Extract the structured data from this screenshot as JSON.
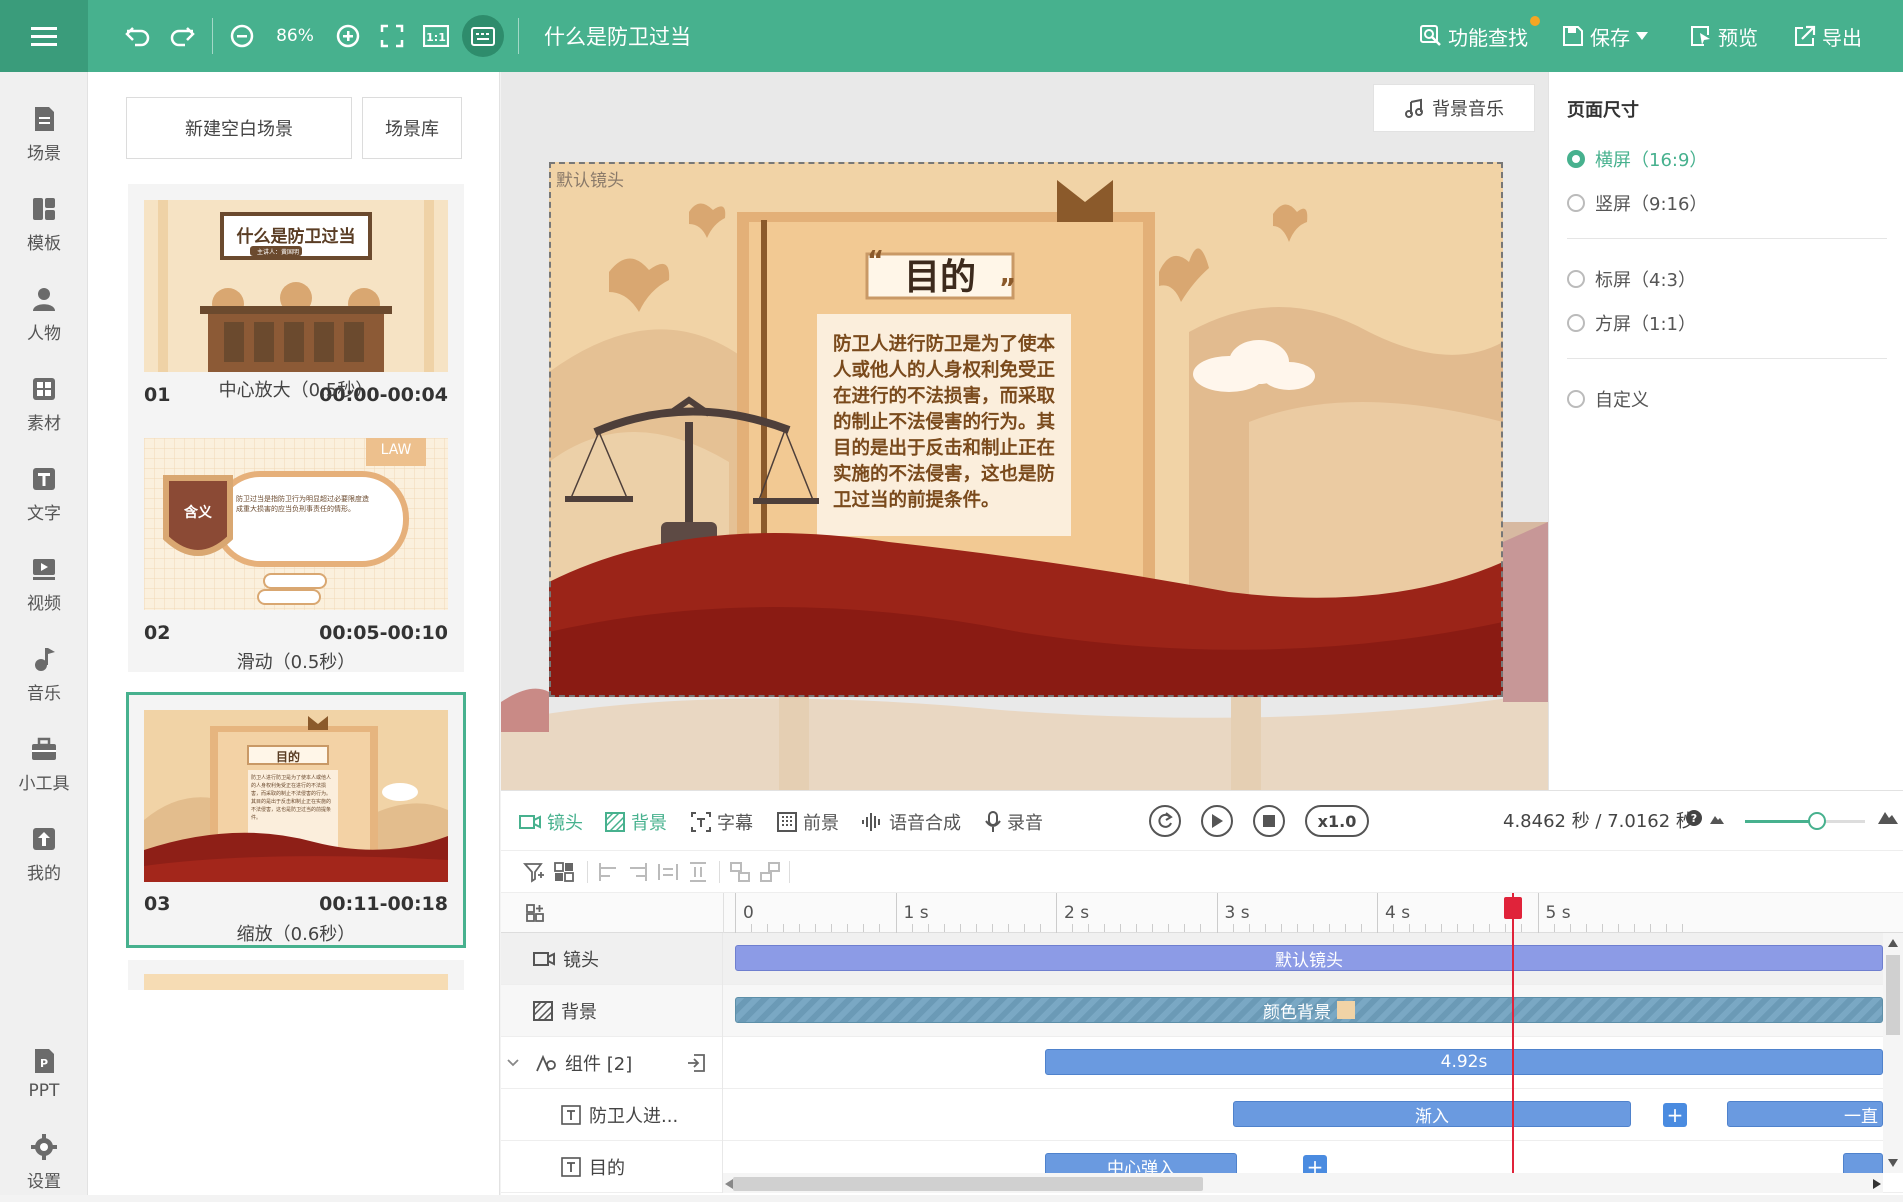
{
  "toolbar": {
    "zoom": "86%",
    "title": "什么是防卫过当",
    "find_label": "功能查找",
    "save_label": "保存",
    "preview_label": "预览",
    "export_label": "导出",
    "accent": "#47b18e"
  },
  "nav": {
    "items": [
      {
        "label": "场景",
        "icon": "scene-icon"
      },
      {
        "label": "模板",
        "icon": "template-icon"
      },
      {
        "label": "人物",
        "icon": "person-icon"
      },
      {
        "label": "素材",
        "icon": "material-icon"
      },
      {
        "label": "文字",
        "icon": "text-icon"
      },
      {
        "label": "视频",
        "icon": "video-icon"
      },
      {
        "label": "音乐",
        "icon": "music-icon"
      },
      {
        "label": "小工具",
        "icon": "toolbox-icon"
      },
      {
        "label": "我的",
        "icon": "upload-icon"
      }
    ],
    "ppt": "PPT",
    "settings": "设置"
  },
  "scenes": {
    "new_blank": "新建空白场景",
    "library": "场景库",
    "list": [
      {
        "num": "01",
        "time": "00:00-00:04",
        "transition": "中心放大（0.5秒）",
        "thumb_title": "什么是防卫过当",
        "thumb_sub": "主讲人：黄国明"
      },
      {
        "num": "02",
        "time": "00:05-00:10",
        "transition": "滑动（0.5秒）",
        "thumb_badge": "LAW",
        "thumb_shield": "含义",
        "thumb_text": "防卫过当是指防卫行为明显超过必要限度造成重大损害的应当负刑事责任的情形。"
      },
      {
        "num": "03",
        "time": "00:11-00:18",
        "transition": "缩放（0.6秒）",
        "thumb_title": "目的"
      }
    ]
  },
  "stage": {
    "bgm": "背景音乐",
    "camera_label": "默认镜头",
    "slide_title": "目的",
    "slide_body": "防卫人进行防卫是为了使本人或他人的人身权利免受正在进行的不法损害，而采取的制止不法侵害的行为。其目的是出于反击和制止正在实施的不法侵害，这也是防卫过当的前提条件。"
  },
  "page_size": {
    "title": "页面尺寸",
    "options": [
      "横屏（16:9）",
      "竖屏（9:16）",
      "标屏（4:3）",
      "方屏（1:1）",
      "自定义"
    ],
    "selected": 0
  },
  "timeline": {
    "tabs": [
      "镜头",
      "背景",
      "字幕",
      "前景",
      "语音合成",
      "录音"
    ],
    "active_tab": 1,
    "speed": "x1.0",
    "time_text": "4.8462 秒 / 7.0162 秒",
    "zoom_fraction": 0.6,
    "ticks": [
      "0",
      "1 s",
      "2 s",
      "3 s",
      "4 s",
      "5 s"
    ],
    "rows": [
      {
        "label": "镜头",
        "icon": "camera-icon"
      },
      {
        "label": "背景",
        "icon": "background-icon"
      },
      {
        "label": "组件 [2]",
        "icon": "component-icon"
      },
      {
        "label": "防卫人进...",
        "icon": "text-icon"
      },
      {
        "label": "目的",
        "icon": "text-icon"
      }
    ],
    "bars": {
      "camera": "默认镜头",
      "background": "颜色背景",
      "group": "4.92s",
      "text1": "渐入",
      "text1_b": "一直",
      "text2": "中心弹入"
    },
    "playhead_seconds": 4.8462
  }
}
